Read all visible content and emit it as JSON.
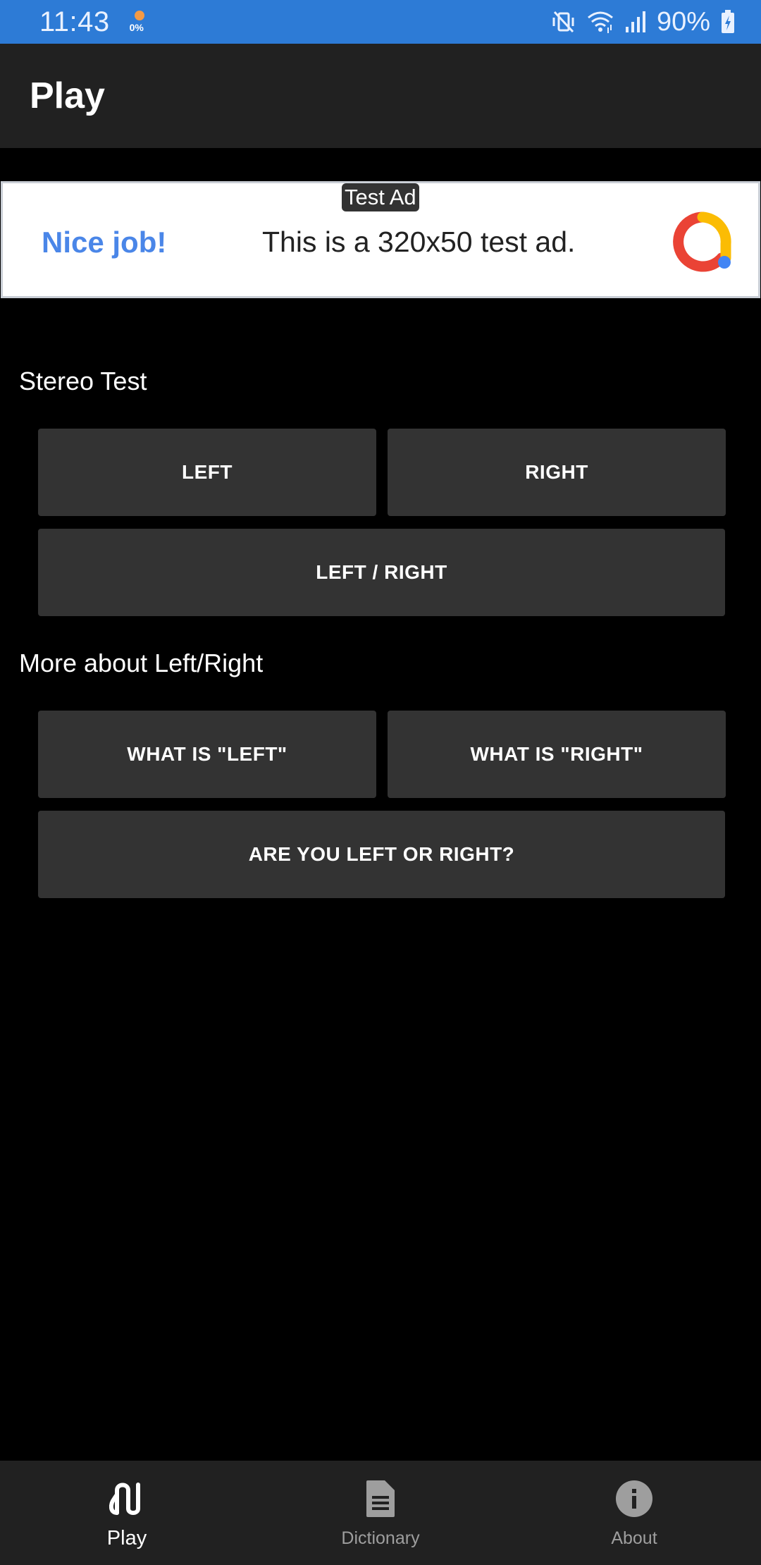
{
  "status_bar": {
    "time": "11:43",
    "notification_percent": "0%",
    "battery_percent": "90%",
    "icons": [
      "mute-vibrate-icon",
      "wifi-icon",
      "signal-icon",
      "battery-charging-icon"
    ],
    "background_color": "#2d7bd6"
  },
  "app_bar": {
    "title": "Play"
  },
  "ad": {
    "badge": "Test Ad",
    "headline": "Nice job!",
    "body": "This is a 320x50 test ad.",
    "logo_icon": "admob-logo-icon",
    "headline_color": "#4a86e8"
  },
  "stereo_test": {
    "title": "Stereo Test",
    "left_label": "LEFT",
    "right_label": "RIGHT",
    "left_right_label": "LEFT / RIGHT"
  },
  "more": {
    "title": "More about Left/Right",
    "what_left_label": "WHAT IS \"LEFT\"",
    "what_right_label": "WHAT IS \"RIGHT\"",
    "are_you_label": "ARE YOU LEFT OR RIGHT?"
  },
  "bottom_nav": {
    "items": [
      {
        "label": "Play",
        "icon": "play-route-icon",
        "active": true
      },
      {
        "label": "Dictionary",
        "icon": "document-icon",
        "active": false
      },
      {
        "label": "About",
        "icon": "info-icon",
        "active": false
      }
    ],
    "button_color": "#333333"
  }
}
